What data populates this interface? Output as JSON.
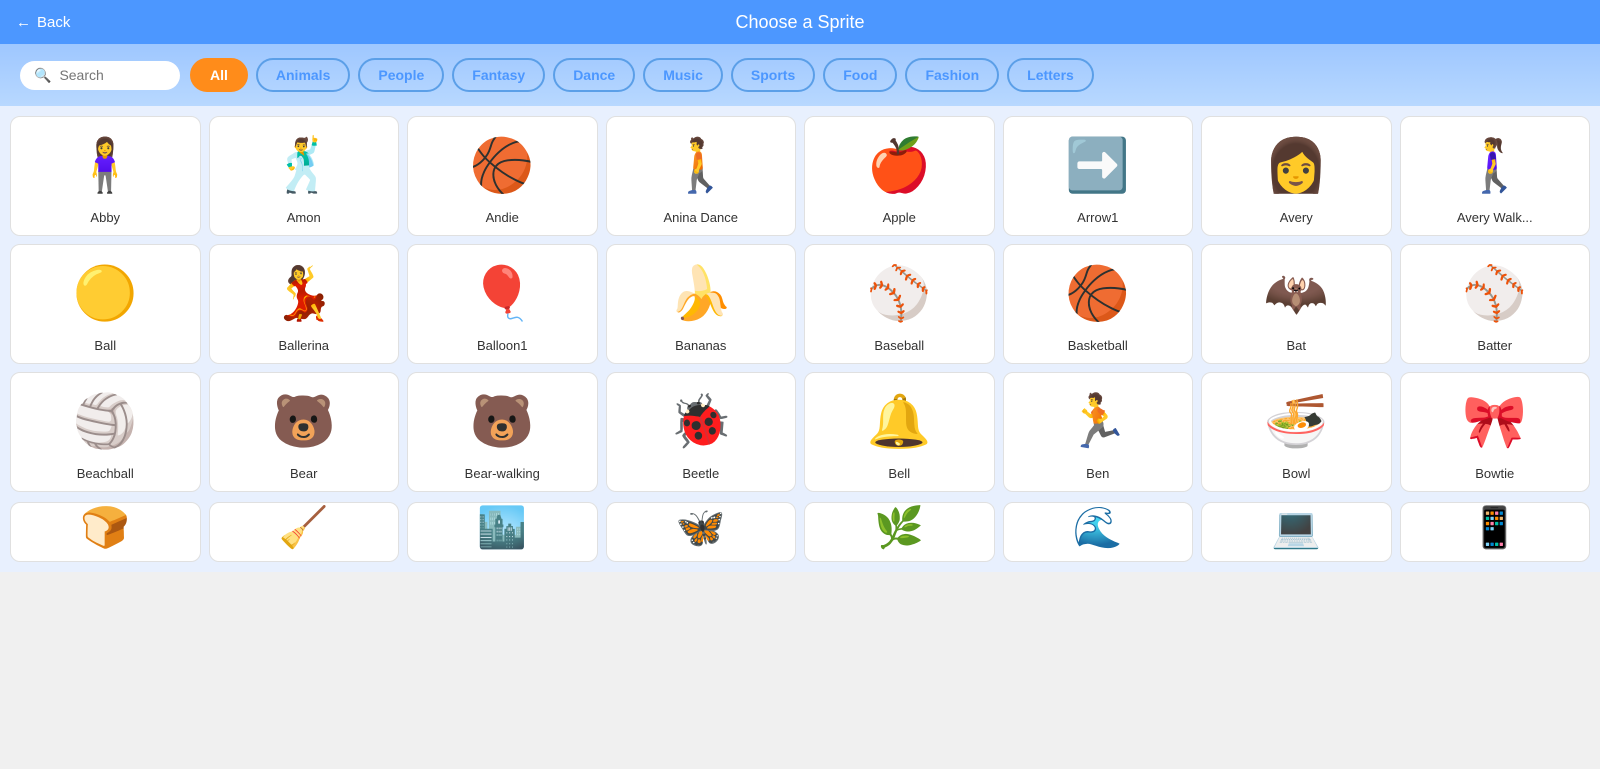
{
  "header": {
    "back_label": "Back",
    "title": "Choose a Sprite"
  },
  "filter_bar": {
    "search_placeholder": "Search",
    "filters": [
      {
        "id": "all",
        "label": "All",
        "active": true
      },
      {
        "id": "animals",
        "label": "Animals",
        "active": false
      },
      {
        "id": "people",
        "label": "People",
        "active": false
      },
      {
        "id": "fantasy",
        "label": "Fantasy",
        "active": false
      },
      {
        "id": "dance",
        "label": "Dance",
        "active": false
      },
      {
        "id": "music",
        "label": "Music",
        "active": false
      },
      {
        "id": "sports",
        "label": "Sports",
        "active": false
      },
      {
        "id": "food",
        "label": "Food",
        "active": false
      },
      {
        "id": "fashion",
        "label": "Fashion",
        "active": false
      },
      {
        "id": "letters",
        "label": "Letters",
        "active": false
      }
    ]
  },
  "sprites": [
    {
      "name": "Abby",
      "emoji": "🧍‍♀️"
    },
    {
      "name": "Amon",
      "emoji": "🕺"
    },
    {
      "name": "Andie",
      "emoji": "🏀"
    },
    {
      "name": "Anina Dance",
      "emoji": "🚶"
    },
    {
      "name": "Apple",
      "emoji": "🍎"
    },
    {
      "name": "Arrow1",
      "emoji": "➡️"
    },
    {
      "name": "Avery",
      "emoji": "👩"
    },
    {
      "name": "Avery Walk...",
      "emoji": "🚶‍♀️"
    },
    {
      "name": "Ball",
      "emoji": "🟡"
    },
    {
      "name": "Ballerina",
      "emoji": "💃"
    },
    {
      "name": "Balloon1",
      "emoji": "🎈"
    },
    {
      "name": "Bananas",
      "emoji": "🍌"
    },
    {
      "name": "Baseball",
      "emoji": "⚾"
    },
    {
      "name": "Basketball",
      "emoji": "🏀"
    },
    {
      "name": "Bat",
      "emoji": "🦇"
    },
    {
      "name": "Batter",
      "emoji": "⚾"
    },
    {
      "name": "Beachball",
      "emoji": "🏐"
    },
    {
      "name": "Bear",
      "emoji": "🐻"
    },
    {
      "name": "Bear-walking",
      "emoji": "🐻"
    },
    {
      "name": "Beetle",
      "emoji": "🐞"
    },
    {
      "name": "Bell",
      "emoji": "🔔"
    },
    {
      "name": "Ben",
      "emoji": "🏃"
    },
    {
      "name": "Bowl",
      "emoji": "🍜"
    },
    {
      "name": "Bowtie",
      "emoji": "🎀"
    }
  ],
  "bottom_sprites": [
    {
      "name": "",
      "emoji": "🍞"
    },
    {
      "name": "",
      "emoji": "🧹"
    },
    {
      "name": "",
      "emoji": "🏙️"
    },
    {
      "name": "",
      "emoji": "🦋"
    },
    {
      "name": "",
      "emoji": "🌿"
    },
    {
      "name": "",
      "emoji": "🌊"
    },
    {
      "name": "",
      "emoji": "💻"
    },
    {
      "name": "",
      "emoji": "📱"
    }
  ]
}
